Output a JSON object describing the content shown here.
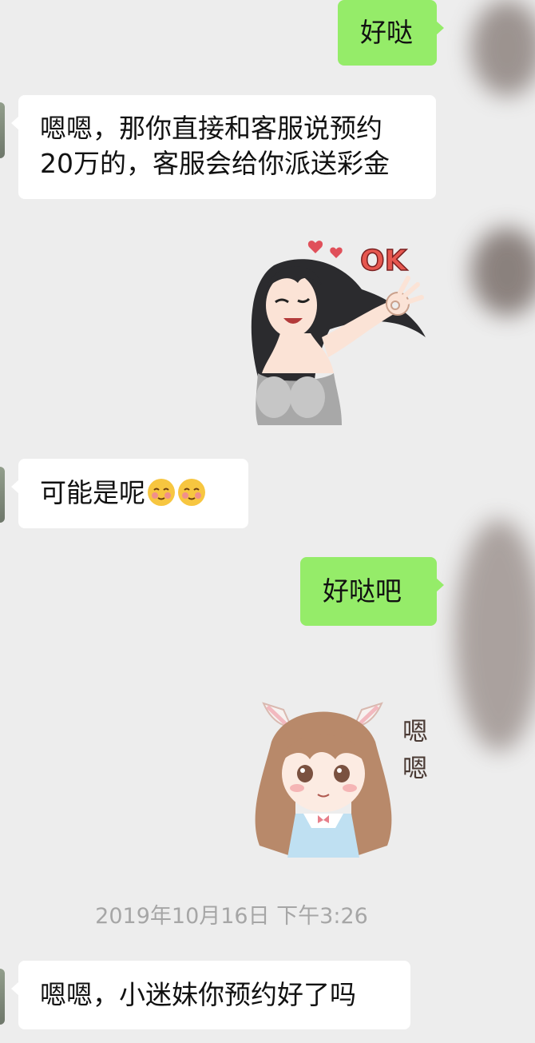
{
  "messages": [
    {
      "side": "right",
      "text": "好哒"
    },
    {
      "side": "left",
      "lines": [
        "嗯嗯，那你直接和客服说预约",
        "20万的，客服会给你派送彩金"
      ]
    },
    {
      "side": "right",
      "sticker": "ok-girl-sticker",
      "sticker_text": "OK"
    },
    {
      "side": "left",
      "text": "可能是呢",
      "emoji": [
        "blush-emoji",
        "blush-emoji"
      ]
    },
    {
      "side": "right",
      "text": "好哒吧"
    },
    {
      "side": "right",
      "sticker": "bunny-ear-girl-sticker",
      "sticker_text": [
        "嗯",
        "嗯"
      ]
    },
    {
      "side": "left",
      "text": "嗯嗯，小迷妹你预约好了吗"
    }
  ],
  "timestamp": "2019年10月16日 下午3:26",
  "colors": {
    "background": "#ededed",
    "sent_bubble": "#95ec69",
    "received_bubble": "#ffffff",
    "timestamp_text": "#a6a6a6"
  }
}
